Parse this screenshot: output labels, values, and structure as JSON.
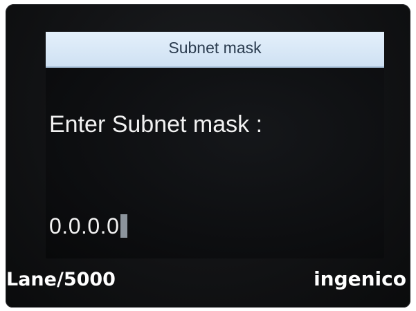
{
  "screen": {
    "title": "Subnet mask",
    "prompt": "Enter Subnet mask :",
    "input_value": "0.0.0.0"
  },
  "device": {
    "model_label": "Lane/5000",
    "brand_logo": "ingenico"
  },
  "colors": {
    "title_bar_background": "#d8e8f7",
    "screen_background": "#0c0d0f",
    "text": "#f2f2f2",
    "cursor": "#8c949c"
  }
}
